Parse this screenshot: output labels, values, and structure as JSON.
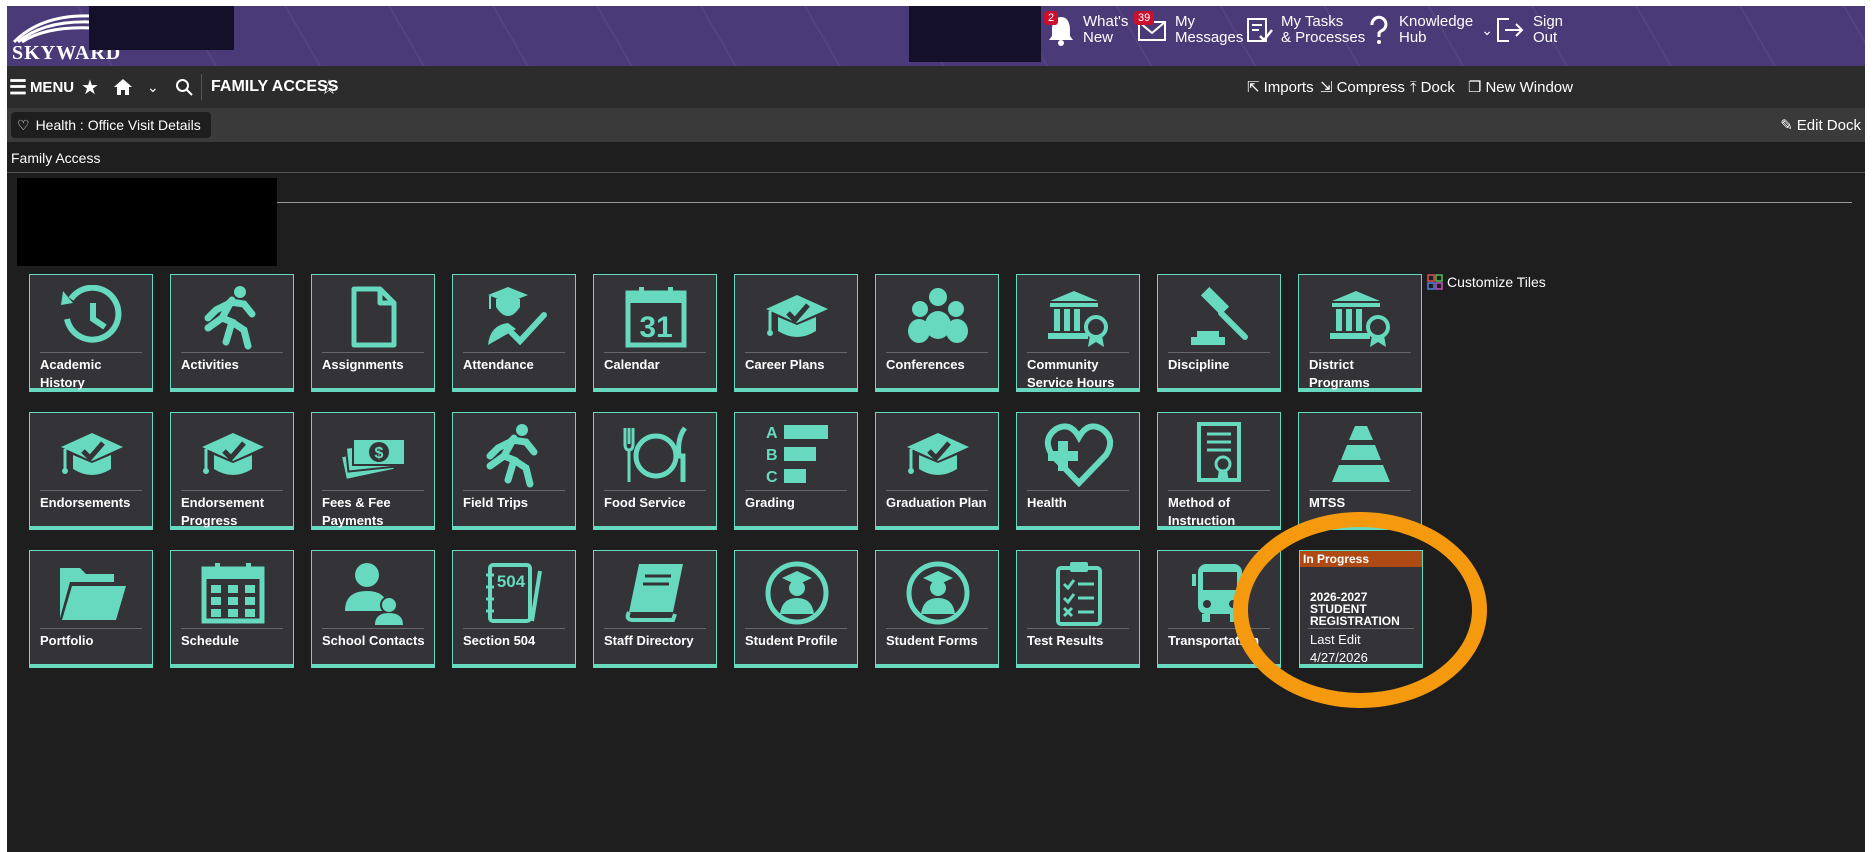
{
  "header": {
    "logo_text": "SKYWARD",
    "items": [
      {
        "label_line1": "What's",
        "label_line2": "New",
        "badge": "2",
        "icon": "bell-icon"
      },
      {
        "label_line1": "My",
        "label_line2": "Messages",
        "badge": "39",
        "icon": "envelope-icon"
      },
      {
        "label_line1": "My Tasks",
        "label_line2": "& Processes",
        "icon": "tasks-icon"
      },
      {
        "label_line1": "Knowledge",
        "label_line2": "Hub",
        "icon": "question-icon"
      },
      {
        "label_line1": "Sign",
        "label_line2": "Out",
        "icon": "sign-out-icon"
      }
    ]
  },
  "navbar": {
    "menu_label": "MENU",
    "title": "FAMILY ACCESS",
    "right_items": [
      "Imports",
      "Compress",
      "Dock",
      "New Window"
    ]
  },
  "tabbar": {
    "tab_label": "Health : Office Visit Details",
    "edit_dock": "Edit Dock"
  },
  "page": {
    "label": "Family Access",
    "customize_tiles": "Customize Tiles"
  },
  "tiles": [
    {
      "label": "Academic History",
      "icon": "history-icon"
    },
    {
      "label": "Activities",
      "icon": "runner-icon"
    },
    {
      "label": "Assignments",
      "icon": "document-icon"
    },
    {
      "label": "Attendance",
      "icon": "graduate-check-icon"
    },
    {
      "label": "Calendar",
      "icon": "calendar-icon",
      "icon_text": "31"
    },
    {
      "label": "Career Plans",
      "icon": "grad-cap-check-icon"
    },
    {
      "label": "Conferences",
      "icon": "people-group-icon"
    },
    {
      "label": "Community Service Hours",
      "icon": "building-ribbon-icon"
    },
    {
      "label": "Discipline",
      "icon": "gavel-icon"
    },
    {
      "label": "District Programs",
      "icon": "building-ribbon-icon"
    },
    {
      "label": "Endorsements",
      "icon": "grad-cap-check-icon"
    },
    {
      "label": "Endorsement Progress",
      "icon": "grad-cap-check-icon"
    },
    {
      "label": "Fees & Fee Payments",
      "icon": "money-icon",
      "icon_text": "$"
    },
    {
      "label": "Field Trips",
      "icon": "runner-icon"
    },
    {
      "label": "Food Service",
      "icon": "plate-utensils-icon"
    },
    {
      "label": "Grading",
      "icon": "grading-bars-icon",
      "icon_letters": [
        "A",
        "B",
        "C"
      ]
    },
    {
      "label": "Graduation Plan",
      "icon": "grad-cap-check-icon"
    },
    {
      "label": "Health",
      "icon": "heart-plus-icon"
    },
    {
      "label": "Method of Instruction",
      "icon": "certificate-icon"
    },
    {
      "label": "MTSS",
      "icon": "pyramid-icon"
    },
    {
      "label": "Portfolio",
      "icon": "folder-icon"
    },
    {
      "label": "Schedule",
      "icon": "schedule-calendar-icon"
    },
    {
      "label": "School Contacts",
      "icon": "contacts-icon"
    },
    {
      "label": "Section 504",
      "icon": "notebook-icon",
      "icon_text": "504"
    },
    {
      "label": "Staff Directory",
      "icon": "book-icon"
    },
    {
      "label": "Student Profile",
      "icon": "student-circle-icon"
    },
    {
      "label": "Student Forms",
      "icon": "student-circle-icon"
    },
    {
      "label": "Test Results",
      "icon": "clipboard-check-icon"
    },
    {
      "label": "Transportation",
      "icon": "bus-icon"
    }
  ],
  "registration": {
    "status": "In Progress",
    "title": "2026-2027 STUDENT REGISTRATION",
    "last_edit_label": "Last Edit",
    "last_edit_date": "4/27/2026"
  },
  "colors": {
    "header_bg": "#4a3a78",
    "tile_accent": "#66d9be",
    "status_badge": "#b04a14",
    "annotation_oval": "#f59a0e",
    "notification_badge": "#c8102e"
  }
}
